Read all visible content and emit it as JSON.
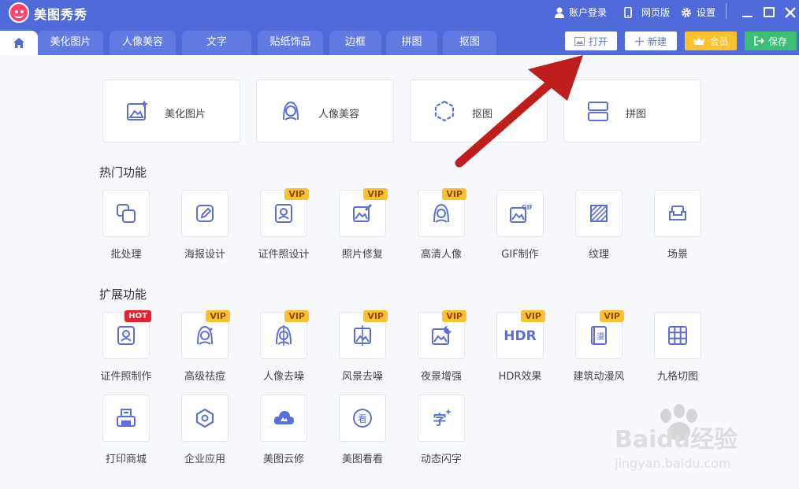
{
  "app": {
    "title": "美图秀秀"
  },
  "titlebar": {
    "account_label": "账户登录",
    "web_label": "网页版",
    "settings_label": "设置"
  },
  "tabs": [
    {
      "label": "美化图片"
    },
    {
      "label": "人像美容"
    },
    {
      "label": "文字"
    },
    {
      "label": "贴纸饰品"
    },
    {
      "label": "边框"
    },
    {
      "label": "拼图"
    },
    {
      "label": "抠图"
    }
  ],
  "actions": {
    "open_label": "打开",
    "new_label": "新建",
    "vip_label": "会员",
    "save_label": "保存"
  },
  "big_cards": [
    {
      "label": "美化图片",
      "icon": "image-edit-icon"
    },
    {
      "label": "人像美容",
      "icon": "portrait-icon"
    },
    {
      "label": "抠图",
      "icon": "hexagon-cutout-icon"
    },
    {
      "label": "拼图",
      "icon": "collage-icon"
    }
  ],
  "sections": {
    "hot": "热门功能",
    "extended": "扩展功能"
  },
  "hot_tools": [
    {
      "label": "批处理",
      "icon": "batch-icon",
      "badge": ""
    },
    {
      "label": "海报设计",
      "icon": "poster-edit-icon",
      "badge": ""
    },
    {
      "label": "证件照设计",
      "icon": "id-photo-icon",
      "badge": "VIP"
    },
    {
      "label": "照片修复",
      "icon": "photo-repair-icon",
      "badge": "VIP"
    },
    {
      "label": "高清人像",
      "icon": "hd-portrait-icon",
      "badge": "VIP"
    },
    {
      "label": "GIF制作",
      "icon": "gif-icon",
      "badge": ""
    },
    {
      "label": "纹理",
      "icon": "texture-icon",
      "badge": ""
    },
    {
      "label": "场景",
      "icon": "scene-sofa-icon",
      "badge": ""
    }
  ],
  "ext_tools": [
    {
      "label": "证件照制作",
      "icon": "id-photo-make-icon",
      "badge": "HOT"
    },
    {
      "label": "高级祛痘",
      "icon": "acne-removal-icon",
      "badge": "VIP"
    },
    {
      "label": "人像去噪",
      "icon": "portrait-denoise-icon",
      "badge": "VIP"
    },
    {
      "label": "风景去噪",
      "icon": "landscape-denoise-icon",
      "badge": "VIP"
    },
    {
      "label": "夜景增强",
      "icon": "night-enhance-icon",
      "badge": "VIP"
    },
    {
      "label": "HDR效果",
      "icon": "hdr-icon",
      "badge": "VIP"
    },
    {
      "label": "建筑动漫风",
      "icon": "comic-building-icon",
      "badge": "VIP"
    },
    {
      "label": "九格切图",
      "icon": "grid-nine-icon",
      "badge": ""
    },
    {
      "label": "打印商城",
      "icon": "printer-icon",
      "badge": ""
    },
    {
      "label": "企业应用",
      "icon": "enterprise-icon",
      "badge": ""
    },
    {
      "label": "美图云修",
      "icon": "cloud-retouch-icon",
      "badge": ""
    },
    {
      "label": "美图看看",
      "icon": "viewer-icon",
      "badge": ""
    },
    {
      "label": "动态闪字",
      "icon": "flash-text-icon",
      "badge": ""
    }
  ],
  "hdr_text": "HDR",
  "gif_text": "GIF",
  "comic_char": "漫",
  "viewer_char": "看",
  "flash_char": "字",
  "watermark": {
    "brand": "Baidu经验",
    "url": "jingyan.baidu.com"
  },
  "colors": {
    "titlebar": "#4f6bd9",
    "accent": "#5b6fd6",
    "vip": "#fdc02f",
    "save": "#3dbe76",
    "arrow": "#c01d1d"
  }
}
